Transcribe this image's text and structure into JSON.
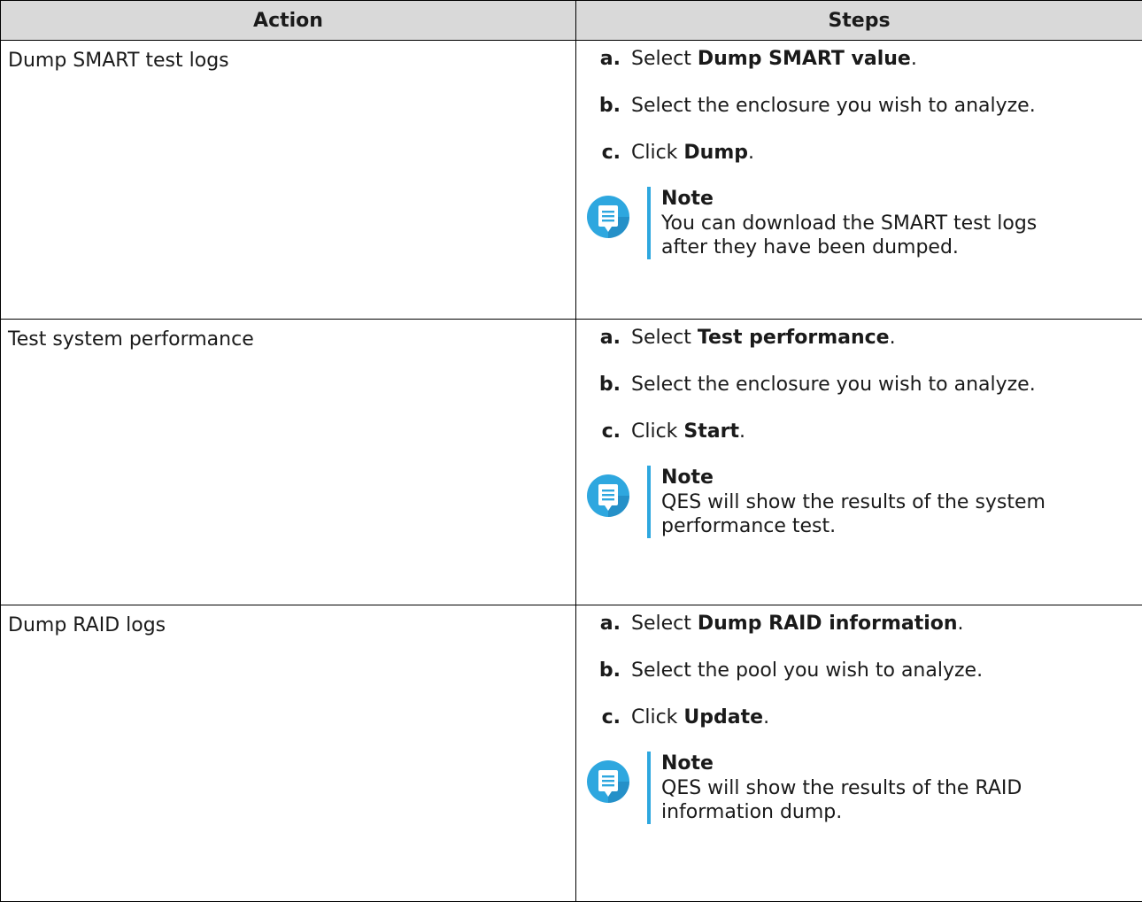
{
  "header": {
    "action": "Action",
    "steps": "Steps"
  },
  "rows": [
    {
      "action": "Dump SMART test logs",
      "steps": [
        {
          "letter": "a.",
          "pre": "Select ",
          "bold": "Dump SMART value",
          "post": "."
        },
        {
          "letter": "b.",
          "pre": "Select the enclosure you wish to analyze.",
          "bold": "",
          "post": ""
        },
        {
          "letter": "c.",
          "pre": "Click ",
          "bold": "Dump",
          "post": "."
        }
      ],
      "note": {
        "title": "Note",
        "lines": [
          "You can download the SMART test logs",
          "after they have been dumped."
        ]
      }
    },
    {
      "action": "Test system performance",
      "steps": [
        {
          "letter": "a.",
          "pre": "Select ",
          "bold": "Test performance",
          "post": "."
        },
        {
          "letter": "b.",
          "pre": "Select the enclosure you wish to analyze.",
          "bold": "",
          "post": ""
        },
        {
          "letter": "c.",
          "pre": "Click ",
          "bold": "Start",
          "post": "."
        }
      ],
      "note": {
        "title": "Note",
        "lines": [
          "QES will show the results of the system",
          "performance test."
        ]
      }
    },
    {
      "action": "Dump RAID logs",
      "steps": [
        {
          "letter": "a.",
          "pre": "Select ",
          "bold": "Dump RAID information",
          "post": "."
        },
        {
          "letter": "b.",
          "pre": "Select the pool you wish to analyze.",
          "bold": "",
          "post": ""
        },
        {
          "letter": "c.",
          "pre": "Click ",
          "bold": "Update",
          "post": "."
        }
      ],
      "note": {
        "title": "Note",
        "lines": [
          "QES will show the results of the RAID",
          "information dump."
        ]
      }
    }
  ],
  "icons": {
    "note": "note-icon"
  },
  "colors": {
    "accent": "#2ea7df",
    "icon_dark": "#1f7db5",
    "header_bg": "#d9d9d9"
  }
}
